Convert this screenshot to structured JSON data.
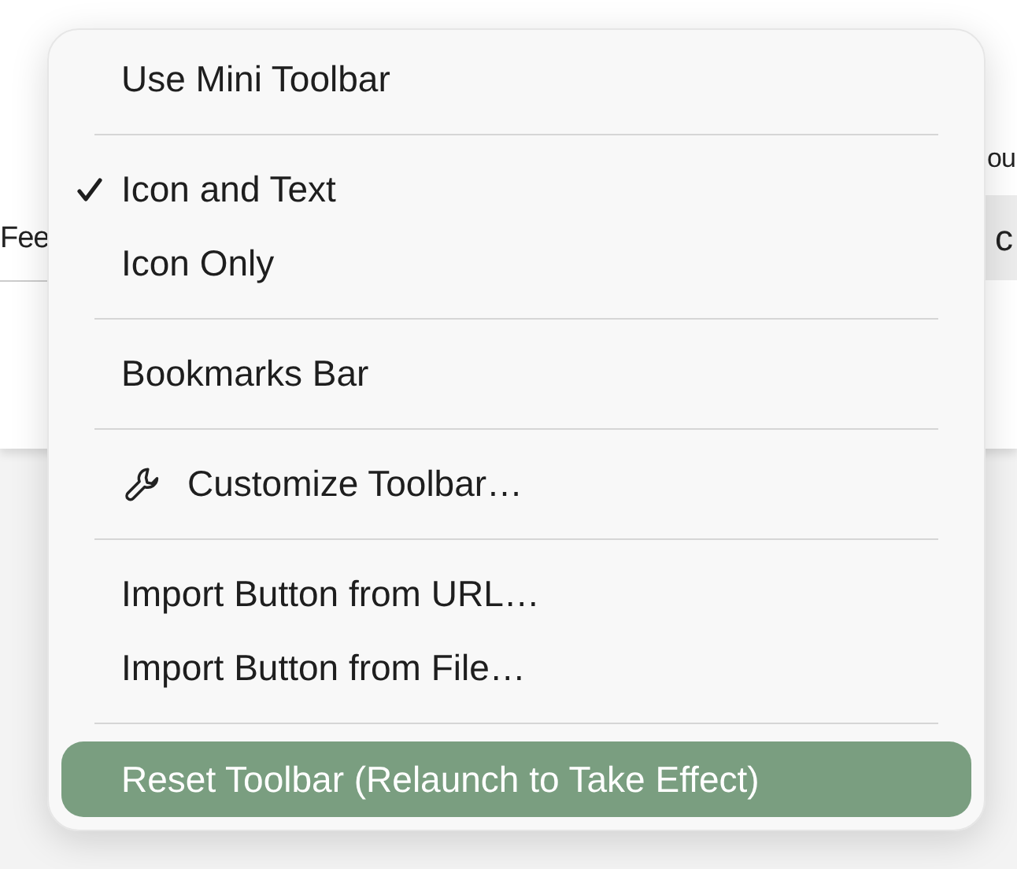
{
  "background_toolbar": {
    "left_label": "Fee",
    "right_top_label": "ou",
    "right_label": "c"
  },
  "menu": {
    "items": [
      {
        "kind": "item",
        "label": "Use Mini Toolbar",
        "checked": false,
        "selected": false
      },
      {
        "kind": "separator"
      },
      {
        "kind": "item",
        "label": "Icon and Text",
        "checked": true,
        "selected": false
      },
      {
        "kind": "item",
        "label": "Icon Only",
        "checked": false,
        "selected": false
      },
      {
        "kind": "separator"
      },
      {
        "kind": "item",
        "label": "Bookmarks Bar",
        "checked": false,
        "selected": false
      },
      {
        "kind": "separator"
      },
      {
        "kind": "tool",
        "label": "Customize Toolbar…",
        "checked": false,
        "selected": false
      },
      {
        "kind": "separator"
      },
      {
        "kind": "item",
        "label": "Import Button from URL…",
        "checked": false,
        "selected": false
      },
      {
        "kind": "item",
        "label": "Import Button from File…",
        "checked": false,
        "selected": false
      },
      {
        "kind": "separator"
      },
      {
        "kind": "item",
        "label": "Reset Toolbar (Relaunch to Take Effect)",
        "checked": false,
        "selected": true
      }
    ]
  }
}
